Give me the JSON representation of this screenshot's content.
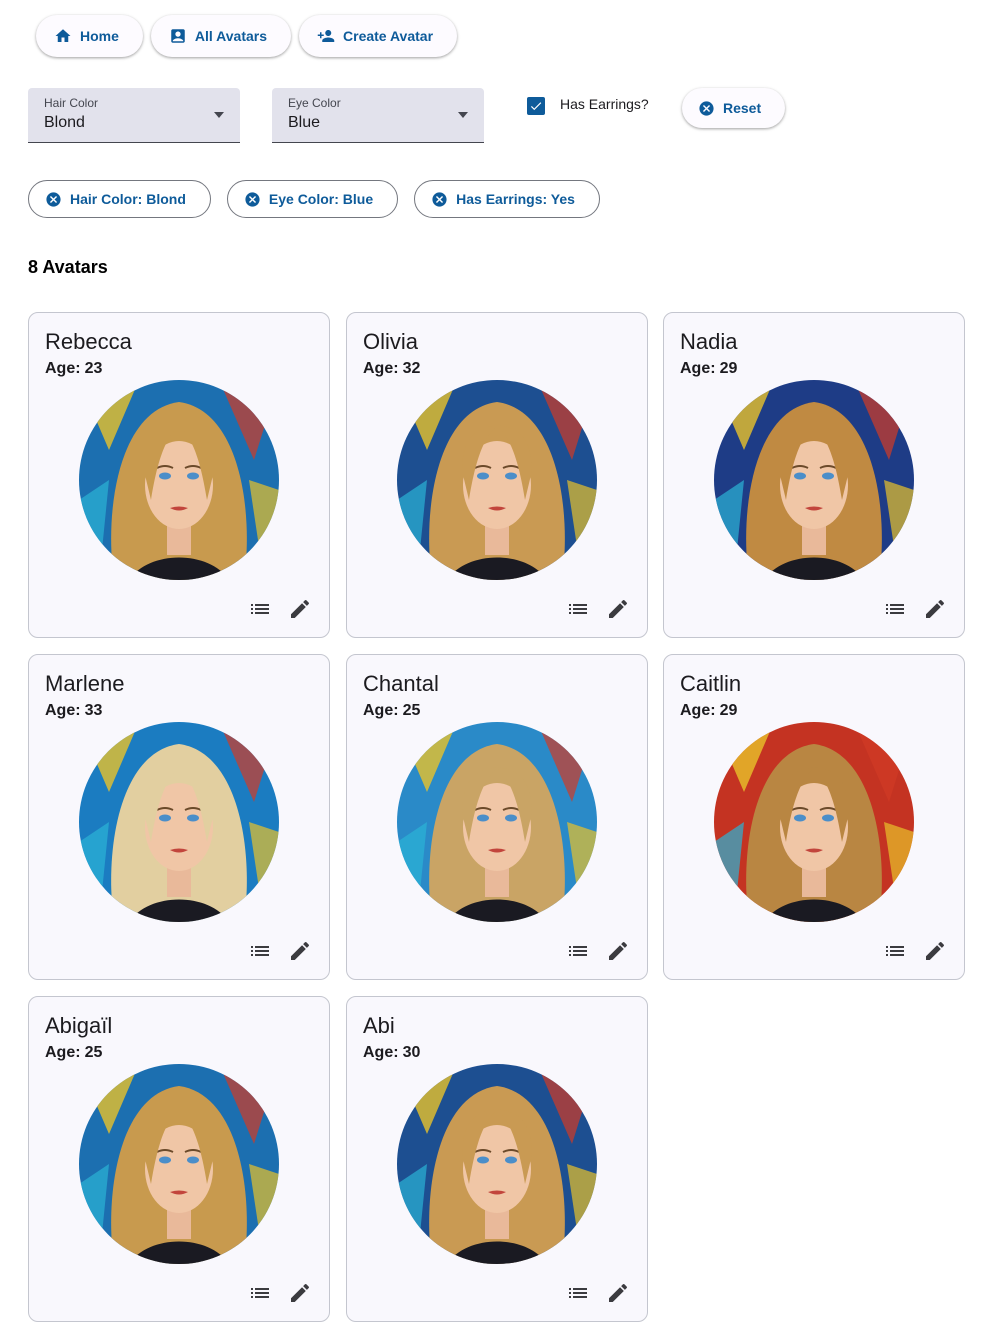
{
  "nav": [
    {
      "label": "Home",
      "icon": "home-icon"
    },
    {
      "label": "All Avatars",
      "icon": "person-card-icon"
    },
    {
      "label": "Create Avatar",
      "icon": "person-add-icon"
    }
  ],
  "filters": {
    "hair": {
      "label": "Hair Color",
      "value": "Blond"
    },
    "eye": {
      "label": "Eye Color",
      "value": "Blue"
    },
    "earrings": {
      "label": "Has Earrings?",
      "checked": true
    },
    "reset_label": "Reset"
  },
  "chips": [
    "Hair Color: Blond",
    "Eye Color: Blue",
    "Has Earrings: Yes"
  ],
  "count_label": "8 Avatars",
  "age_prefix": "Age:",
  "avatars": [
    {
      "name": "Rebecca",
      "age": "23",
      "hair": "#c89a4e",
      "bg": "#1c6fb0"
    },
    {
      "name": "Olivia",
      "age": "32",
      "hair": "#c99a53",
      "bg": "#1d4f91"
    },
    {
      "name": "Nadia",
      "age": "29",
      "hair": "#c08a42",
      "bg": "#1e3c86"
    },
    {
      "name": "Marlene",
      "age": "33",
      "hair": "#e2cfa0",
      "bg": "#1b7cc1"
    },
    {
      "name": "Chantal",
      "age": "25",
      "hair": "#c9a465",
      "bg": "#2a8ac8"
    },
    {
      "name": "Caitlin",
      "age": "29",
      "hair": "#b98642",
      "bg": "#c43322"
    },
    {
      "name": "Abigaïl",
      "age": "25",
      "hair": "#c89a4e",
      "bg": "#1c6fb0"
    },
    {
      "name": "Abi",
      "age": "30",
      "hair": "#c99a53",
      "bg": "#1d4f91"
    }
  ],
  "colors": {
    "primary": "#0e5b9a",
    "card_bg": "#f9f8fd",
    "select_bg": "#e2e2ec"
  }
}
